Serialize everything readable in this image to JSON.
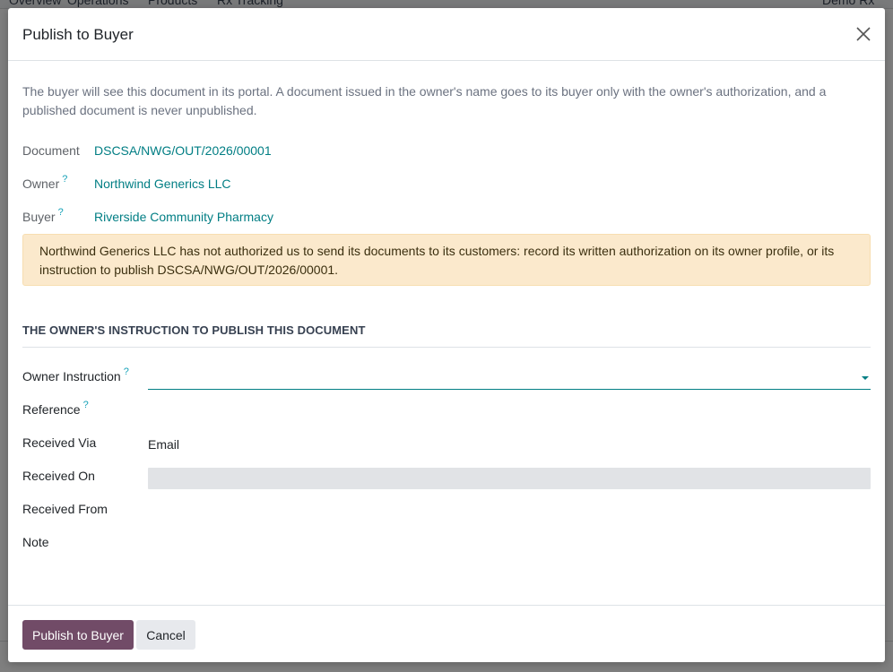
{
  "background": {
    "nav_items": [
      "Overview",
      "Operations",
      "Products",
      "Rx Tracking"
    ],
    "user_name": "Demo Rx Dis"
  },
  "dialog": {
    "title": "Publish to Buyer",
    "intro": "The buyer will see this document in its portal. A document issued in the owner's name goes to its buyer only with the owner's authorization, and a published document is never unpublished.",
    "fields": {
      "document_label": "Document",
      "document_value": "DSCSA/NWG/OUT/2026/00001",
      "owner_label": "Owner",
      "owner_value": "Northwind Generics LLC",
      "buyer_label": "Buyer",
      "buyer_value": "Riverside Community Pharmacy"
    },
    "help_marker": "?",
    "warning": "Northwind Generics LLC has not authorized us to send its documents to its customers: record its written authorization on its owner profile, or its instruction to publish DSCSA/NWG/OUT/2026/00001.",
    "section_title": "THE OWNER'S INSTRUCTION TO PUBLISH THIS DOCUMENT",
    "form": {
      "owner_instruction_label": "Owner Instruction",
      "owner_instruction_value": "",
      "reference_label": "Reference",
      "received_via_label": "Received Via",
      "received_via_value": "Email",
      "received_on_label": "Received On",
      "received_from_label": "Received From",
      "note_label": "Note"
    },
    "buttons": {
      "publish": "Publish to Buyer",
      "cancel": "Cancel"
    }
  },
  "colors": {
    "primary": "#714b67",
    "link": "#017e84",
    "warning_bg": "#fbe9cc"
  }
}
